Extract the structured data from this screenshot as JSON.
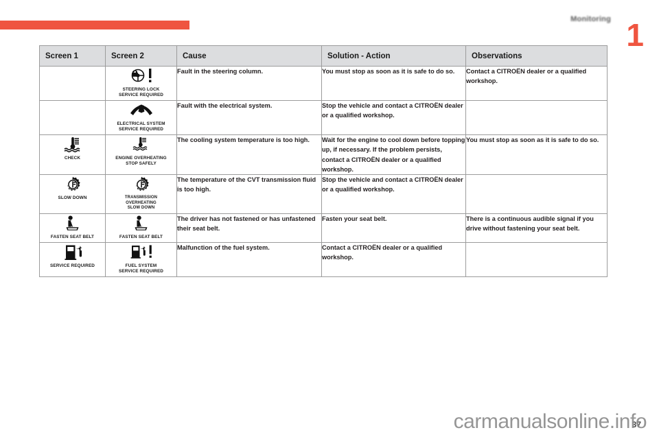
{
  "header": {
    "chapter_title": "Monitoring",
    "chapter_number": "1"
  },
  "table": {
    "columns": [
      "Screen 1",
      "Screen 2",
      "Cause",
      "Solution - Action",
      "Observations"
    ],
    "rows": [
      {
        "screen1": null,
        "screen2": {
          "icon": "steering-lock-icon",
          "caption": "STEERING LOCK\nSERVICE REQUIRED"
        },
        "cause": "Fault in the steering column.",
        "solution": "You must stop as soon as it is safe to do so.",
        "observations": "Contact a CITROËN dealer or a qualified workshop."
      },
      {
        "screen1": null,
        "screen2": {
          "icon": "electrical-system-icon",
          "caption": "ELECTRICAL SYSTEM\nSERVICE REQUIRED"
        },
        "cause": "Fault with the electrical system.",
        "solution": "Stop the vehicle and contact a CITROËN dealer or a qualified workshop.",
        "observations": ""
      },
      {
        "screen1": {
          "icon": "coolant-temperature-icon",
          "caption": "CHECK"
        },
        "screen2": {
          "icon": "engine-overheating-icon",
          "caption": "ENGINE OVERHEATING\nSTOP SAFELY"
        },
        "cause": "The cooling system temperature is too high.",
        "solution": "Wait for the engine to cool down before topping up, if necessary. If the problem persists, contact a CITROËN dealer or a qualified workshop.",
        "observations": "You must stop as soon as it is safe to do so."
      },
      {
        "screen1": {
          "icon": "transmission-gear-icon",
          "caption": "SLOW DOWN"
        },
        "screen2": {
          "icon": "transmission-gear-icon",
          "caption": "TRANSMISSION\nOVERHEATING\nSLOW DOWN"
        },
        "cause": "The temperature of the CVT transmission fluid is too high.",
        "solution": "Stop the vehicle and contact a CITROËN dealer or a qualified workshop.",
        "observations": ""
      },
      {
        "screen1": {
          "icon": "fasten-seat-belt-icon",
          "caption": "FASTEN SEAT BELT"
        },
        "screen2": {
          "icon": "fasten-seat-belt-icon",
          "caption": "FASTEN SEAT BELT"
        },
        "cause": "The driver has not fastened or has unfastened their seat belt.",
        "solution": "Fasten your seat belt.",
        "observations": "There is a continuous audible signal if you drive without fastening your seat belt."
      },
      {
        "screen1": {
          "icon": "fuel-pump-icon",
          "caption": "SERVICE REQUIRED"
        },
        "screen2": {
          "icon": "fuel-system-icon",
          "caption": "FUEL SYSTEM\nSERVICE REQUIRED"
        },
        "cause": "Malfunction of the fuel system.",
        "solution": "Contact a CITROËN dealer or a qualified workshop.",
        "observations": ""
      }
    ]
  },
  "footer": {
    "page_number": "37",
    "watermark": "carmanualsonline.info"
  },
  "colors": {
    "accent": "#ef5540",
    "header_row": "#dcdddf",
    "border": "#9b9b9b",
    "text": "#231f20"
  }
}
